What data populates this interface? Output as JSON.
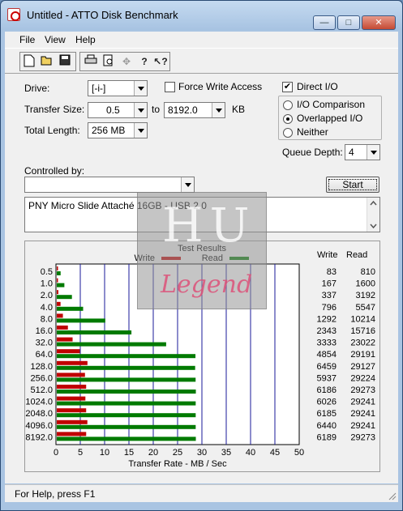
{
  "window": {
    "title": "Untitled - ATTO Disk Benchmark",
    "minimize": "—",
    "maximize": "□",
    "close": "✕"
  },
  "menu": [
    "File",
    "View",
    "Help"
  ],
  "toolbar": {
    "icons": [
      "new-icon",
      "open-icon",
      "save-icon",
      "print-icon",
      "print-preview-icon",
      "move-icon",
      "help-icon",
      "context-help-icon"
    ]
  },
  "form": {
    "drive_label": "Drive:",
    "drive_value": "[-i-]",
    "transfer_size_label": "Transfer Size:",
    "transfer_from": "0.5",
    "to_label": "to",
    "transfer_to": "8192.0",
    "kb_label": "KB",
    "total_length_label": "Total Length:",
    "total_length_value": "256 MB",
    "force_write_label": "Force Write Access",
    "force_write_checked": false,
    "direct_io_label": "Direct I/O",
    "direct_io_checked": true,
    "io_comparison_label": "I/O Comparison",
    "overlapped_io_label": "Overlapped I/O",
    "neither_label": "Neither",
    "selected_mode": "Overlapped I/O",
    "queue_depth_label": "Queue Depth:",
    "queue_depth_value": "4",
    "controlled_by_label": "Controlled by:",
    "controlled_by_value": "",
    "start_label": "Start",
    "description": "PNY Micro Slide Attaché 16GB - USB 2.0"
  },
  "watermark": {
    "top_text": "HU",
    "bottom_text": "Legend"
  },
  "chart_data": {
    "type": "bar",
    "orientation": "horizontal",
    "title": "Test Results",
    "xlabel": "Transfer Rate - MB / Sec",
    "xlim": [
      0,
      50
    ],
    "xticks": [
      0,
      5,
      10,
      15,
      20,
      25,
      30,
      35,
      40,
      45,
      50
    ],
    "categories": [
      "0.5",
      "1.0",
      "2.0",
      "4.0",
      "8.0",
      "16.0",
      "32.0",
      "64.0",
      "128.0",
      "256.0",
      "512.0",
      "1024.0",
      "2048.0",
      "4096.0",
      "8192.0"
    ],
    "series": [
      {
        "name": "Write",
        "color": "#c00000",
        "values_kb": [
          83,
          167,
          337,
          796,
          1292,
          2343,
          3333,
          4854,
          6459,
          5937,
          6186,
          6026,
          6185,
          6440,
          6189
        ]
      },
      {
        "name": "Read",
        "color": "#007a00",
        "values_kb": [
          810,
          1600,
          3192,
          5547,
          10214,
          15716,
          23022,
          29191,
          29127,
          29224,
          29273,
          29241,
          29241,
          29241,
          29273
        ]
      }
    ],
    "column_headers": [
      "Write",
      "Read"
    ],
    "grid": true,
    "legend": "top"
  },
  "status": {
    "text": "For Help, press F1"
  }
}
